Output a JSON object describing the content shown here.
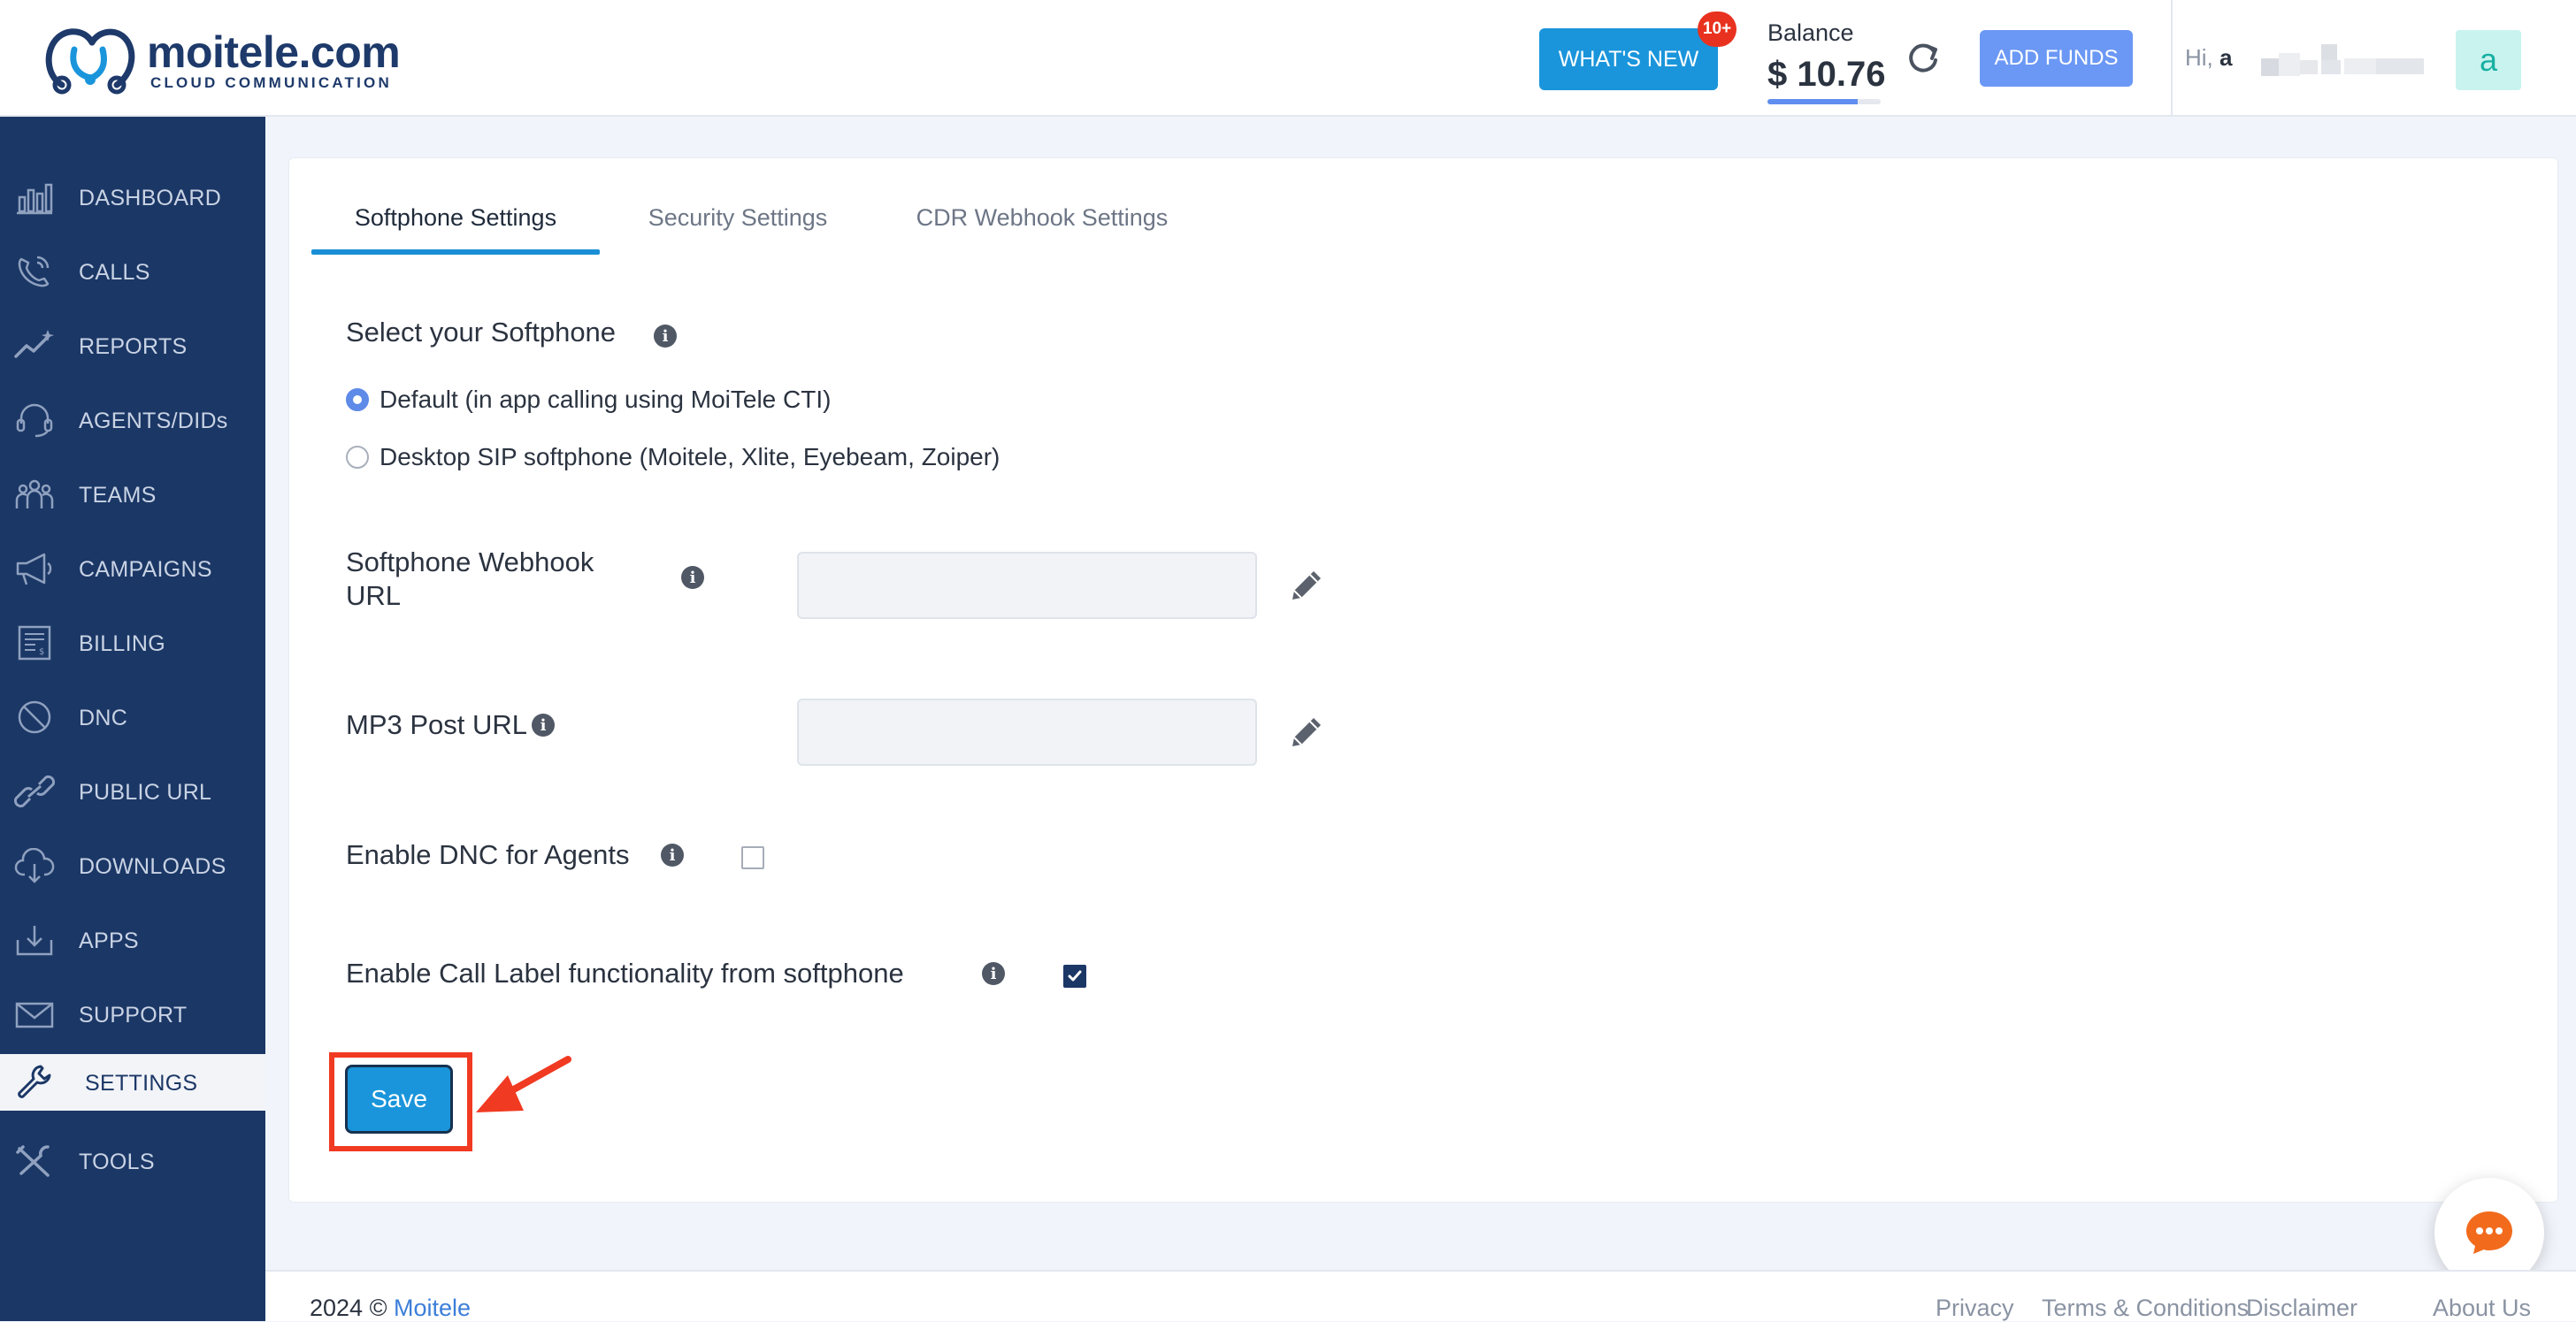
{
  "brand": {
    "name": "moitele",
    "tld": ".com",
    "tagline": "CLOUD COMMUNICATION"
  },
  "header": {
    "whats_new_label": "WHAT'S NEW",
    "notification_badge": "10+",
    "balance_label": "Balance",
    "balance_value": "$ 10.76",
    "balance_progress": 0.8,
    "add_funds_label": "ADD FUNDS",
    "greeting_prefix": "Hi,",
    "greeting_initial": "a",
    "avatar_letter": "a"
  },
  "sidebar": {
    "items": [
      {
        "label": "DASHBOARD",
        "icon": "dashboard-icon"
      },
      {
        "label": "CALLS",
        "icon": "calls-icon"
      },
      {
        "label": "REPORTS",
        "icon": "reports-icon"
      },
      {
        "label": "AGENTS/DIDs",
        "icon": "headset-icon"
      },
      {
        "label": "TEAMS",
        "icon": "teams-icon"
      },
      {
        "label": "CAMPAIGNS",
        "icon": "megaphone-icon"
      },
      {
        "label": "BILLING",
        "icon": "billing-icon"
      },
      {
        "label": "DNC",
        "icon": "ban-icon"
      },
      {
        "label": "PUBLIC URL",
        "icon": "link-icon"
      },
      {
        "label": "DOWNLOADS",
        "icon": "cloud-download-icon"
      },
      {
        "label": "APPS",
        "icon": "apps-download-icon"
      },
      {
        "label": "SUPPORT",
        "icon": "mail-icon"
      },
      {
        "label": "SETTINGS",
        "icon": "wrench-icon"
      },
      {
        "label": "TOOLS",
        "icon": "tools-icon"
      }
    ],
    "active_item": "SETTINGS"
  },
  "tabs": [
    {
      "label": "Softphone Settings",
      "active": true
    },
    {
      "label": "Security Settings",
      "active": false
    },
    {
      "label": "CDR Webhook Settings",
      "active": false
    }
  ],
  "softphone": {
    "select_title": "Select your Softphone",
    "options": [
      {
        "label": "Default (in app calling using MoiTele CTI)",
        "selected": true
      },
      {
        "label": "Desktop SIP softphone (Moitele, Xlite, Eyebeam, Zoiper)",
        "selected": false
      }
    ],
    "webhook_label": "Softphone Webhook URL",
    "webhook_value": "",
    "mp3_label": "MP3 Post URL",
    "mp3_value": "",
    "dnc_label": "Enable DNC for Agents",
    "dnc_enabled": false,
    "call_label_label": "Enable Call Label functionality from softphone",
    "call_label_enabled": true,
    "save_label": "Save"
  },
  "footer": {
    "year": "2024 ©",
    "company": "Moitele",
    "links": [
      "Privacy",
      "Terms & Conditions",
      "Disclaimer",
      "About Us"
    ]
  },
  "colors": {
    "sidebar_bg": "#1b3766",
    "primary_button": "#1a95db",
    "add_funds": "#6b98f5",
    "highlight": "#f13a22",
    "badge": "#e8321f"
  }
}
